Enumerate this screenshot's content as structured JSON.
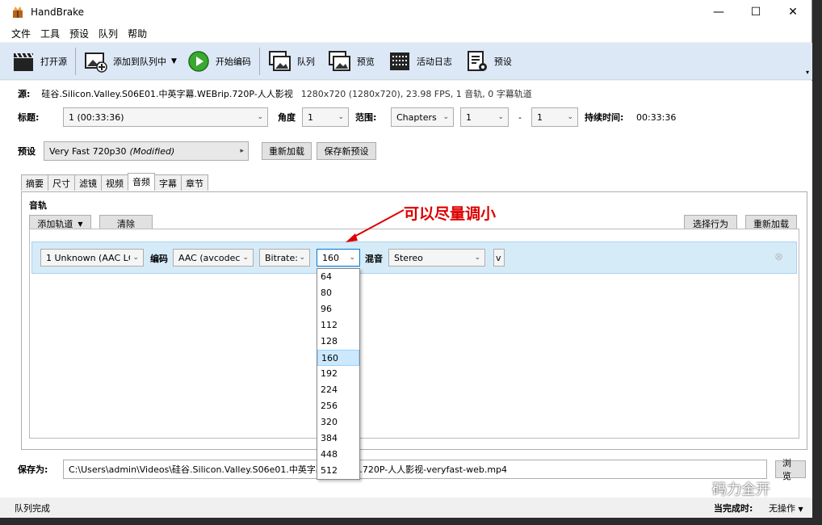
{
  "window": {
    "title": "HandBrake"
  },
  "menu": [
    "文件",
    "工具",
    "预设",
    "队列",
    "帮助"
  ],
  "toolbar": {
    "open": "打开源",
    "add_queue": "添加到队列中",
    "start": "开始编码",
    "queue": "队列",
    "preview": "预览",
    "activity": "活动日志",
    "presets": "预设"
  },
  "source": {
    "label": "源:",
    "name": "硅谷.Silicon.Valley.S06E01.中英字幕.WEBrip.720P-人人影视",
    "info": "1280x720 (1280x720), 23.98 FPS, 1 音轨, 0 字幕轨道"
  },
  "title_row": {
    "label": "标题:",
    "value": "1 (00:33:36)",
    "angle_label": "角度",
    "angle": "1",
    "range_label": "范围:",
    "range_type": "Chapters",
    "range_start": "1",
    "dash": "-",
    "range_end": "1",
    "duration_label": "持续时间:",
    "duration": "00:33:36"
  },
  "preset_row": {
    "label": "预设",
    "value": "Very Fast 720p30",
    "modified": "(Modified)",
    "reload": "重新加载",
    "save_new": "保存新预设"
  },
  "tabs": [
    "摘要",
    "尺寸",
    "滤镜",
    "视频",
    "音频",
    "字幕",
    "章节"
  ],
  "audio": {
    "section": "音轨",
    "add_track": "添加轨道",
    "clear": "清除",
    "select_behavior": "选择行为",
    "reload": "重新加载",
    "track": {
      "source": "1 Unknown (AAC LC",
      "codec_label": "编码",
      "codec": "AAC (avcodec",
      "bitrate_mode": "Bitrate:",
      "bitrate": "160",
      "mix_label": "混音",
      "mix": "Stereo",
      "extra": "v"
    },
    "bitrate_options": [
      "64",
      "80",
      "96",
      "112",
      "128",
      "160",
      "192",
      "224",
      "256",
      "320",
      "384",
      "448",
      "512"
    ],
    "selected_bitrate": "160"
  },
  "annotation": "可以尽量调小",
  "save": {
    "label": "保存为:",
    "path": "C:\\Users\\admin\\Videos\\硅谷.Silicon.Valley.S06e01.中英字幕.WEBrip.720P-人人影视-veryfast-web.mp4",
    "browse": "浏览"
  },
  "status": {
    "text": "队列完成",
    "when_done_label": "当完成时:",
    "when_done": "无操作"
  },
  "watermark": "码力全开"
}
